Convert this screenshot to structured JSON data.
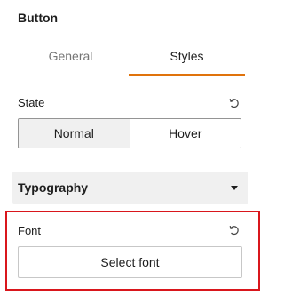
{
  "panel": {
    "title": "Button"
  },
  "tabs": [
    {
      "label": "General",
      "active": false
    },
    {
      "label": "Styles",
      "active": true
    }
  ],
  "state": {
    "label": "State",
    "options": [
      {
        "label": "Normal",
        "selected": true
      },
      {
        "label": "Hover",
        "selected": false
      }
    ]
  },
  "typography": {
    "title": "Typography",
    "expanded": true
  },
  "font": {
    "label": "Font",
    "button_label": "Select font"
  },
  "colors": {
    "accent": "#e0730c",
    "highlight_border": "#d9161c"
  },
  "icons": {
    "reset": "reset-icon",
    "caret": "caret-down-icon"
  }
}
